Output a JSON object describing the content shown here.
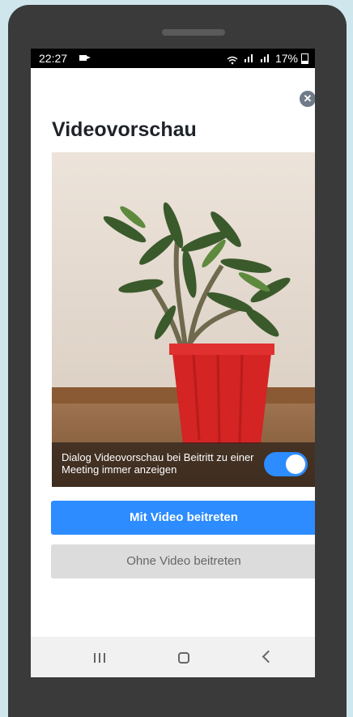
{
  "status_bar": {
    "time": "22:27",
    "battery": "17%"
  },
  "dialog": {
    "title": "Videovorschau",
    "preview_overlay_text": "Dialog Videovorschau bei Beitritt zu einer Meeting immer anzeigen",
    "always_show_toggle_on": true,
    "join_with_video_label": "Mit Video beitreten",
    "join_without_video_label": "Ohne Video beitreten"
  },
  "icons": {
    "close": "close-icon",
    "recents": "recents-icon",
    "home": "home-icon",
    "back": "back-icon"
  },
  "colors": {
    "accent": "#2d8cff",
    "secondary_button": "#dcdcdc",
    "pot": "#d42424"
  }
}
